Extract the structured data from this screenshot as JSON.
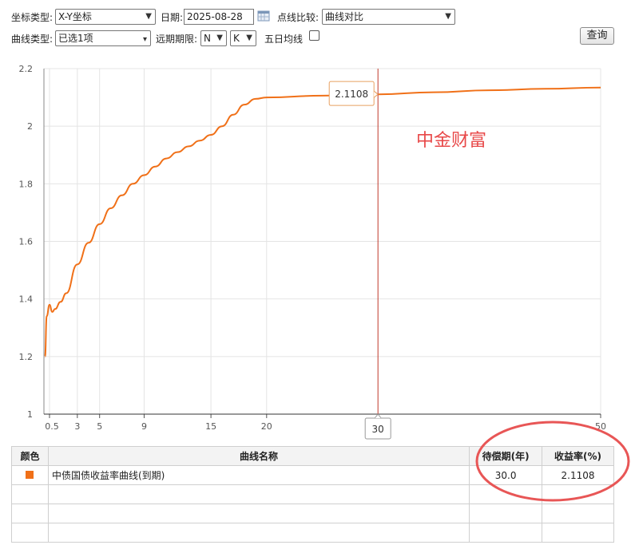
{
  "controls": {
    "coord_type_label": "坐标类型:",
    "coord_type_value": "X-Y坐标",
    "date_label": "日期:",
    "date_value": "2025-08-28",
    "compare_label": "点线比较:",
    "compare_value": "曲线对比",
    "curve_type_label": "曲线类型:",
    "curve_type_value": "已选1项",
    "far_limit_label": "远期期限:",
    "far_limit_n": "N",
    "far_limit_k": "K",
    "ma5_label": "五日均线",
    "query_button": "查询"
  },
  "chart_data": {
    "type": "line",
    "x_ticks": [
      "0.5",
      "3",
      "5",
      "9",
      "15",
      "20",
      "50"
    ],
    "y_ticks": [
      "1",
      "1.2",
      "1.4",
      "1.6",
      "1.8",
      "2",
      "2.2"
    ],
    "ylim": [
      1,
      2.2
    ],
    "crosshair": {
      "x": 30,
      "x_label": "30",
      "y_label": "2.1108"
    },
    "watermark": "中金财富",
    "series": [
      {
        "color": "#f07018",
        "x": [
          0.1,
          0.25,
          0.5,
          0.75,
          1,
          1.5,
          2,
          3,
          4,
          5,
          6,
          7,
          8,
          9,
          10,
          11,
          12,
          13,
          14,
          15,
          16,
          17,
          18,
          19,
          20,
          25,
          30,
          35,
          40,
          45,
          50
        ],
        "y": [
          1.2,
          1.34,
          1.38,
          1.355,
          1.365,
          1.39,
          1.42,
          1.52,
          1.595,
          1.66,
          1.715,
          1.76,
          1.8,
          1.83,
          1.86,
          1.888,
          1.91,
          1.93,
          1.95,
          1.97,
          2.0,
          2.04,
          2.075,
          2.095,
          2.1,
          2.106,
          2.1108,
          2.118,
          2.125,
          2.13,
          2.134
        ]
      }
    ]
  },
  "table": {
    "headers": [
      "颜色",
      "曲线名称",
      "待偿期(年)",
      "收益率(%)"
    ],
    "rows": [
      {
        "color": "#f07018",
        "name": "中债国债收益率曲线(到期)",
        "term": "30.0",
        "yield": "2.1108"
      }
    ]
  }
}
